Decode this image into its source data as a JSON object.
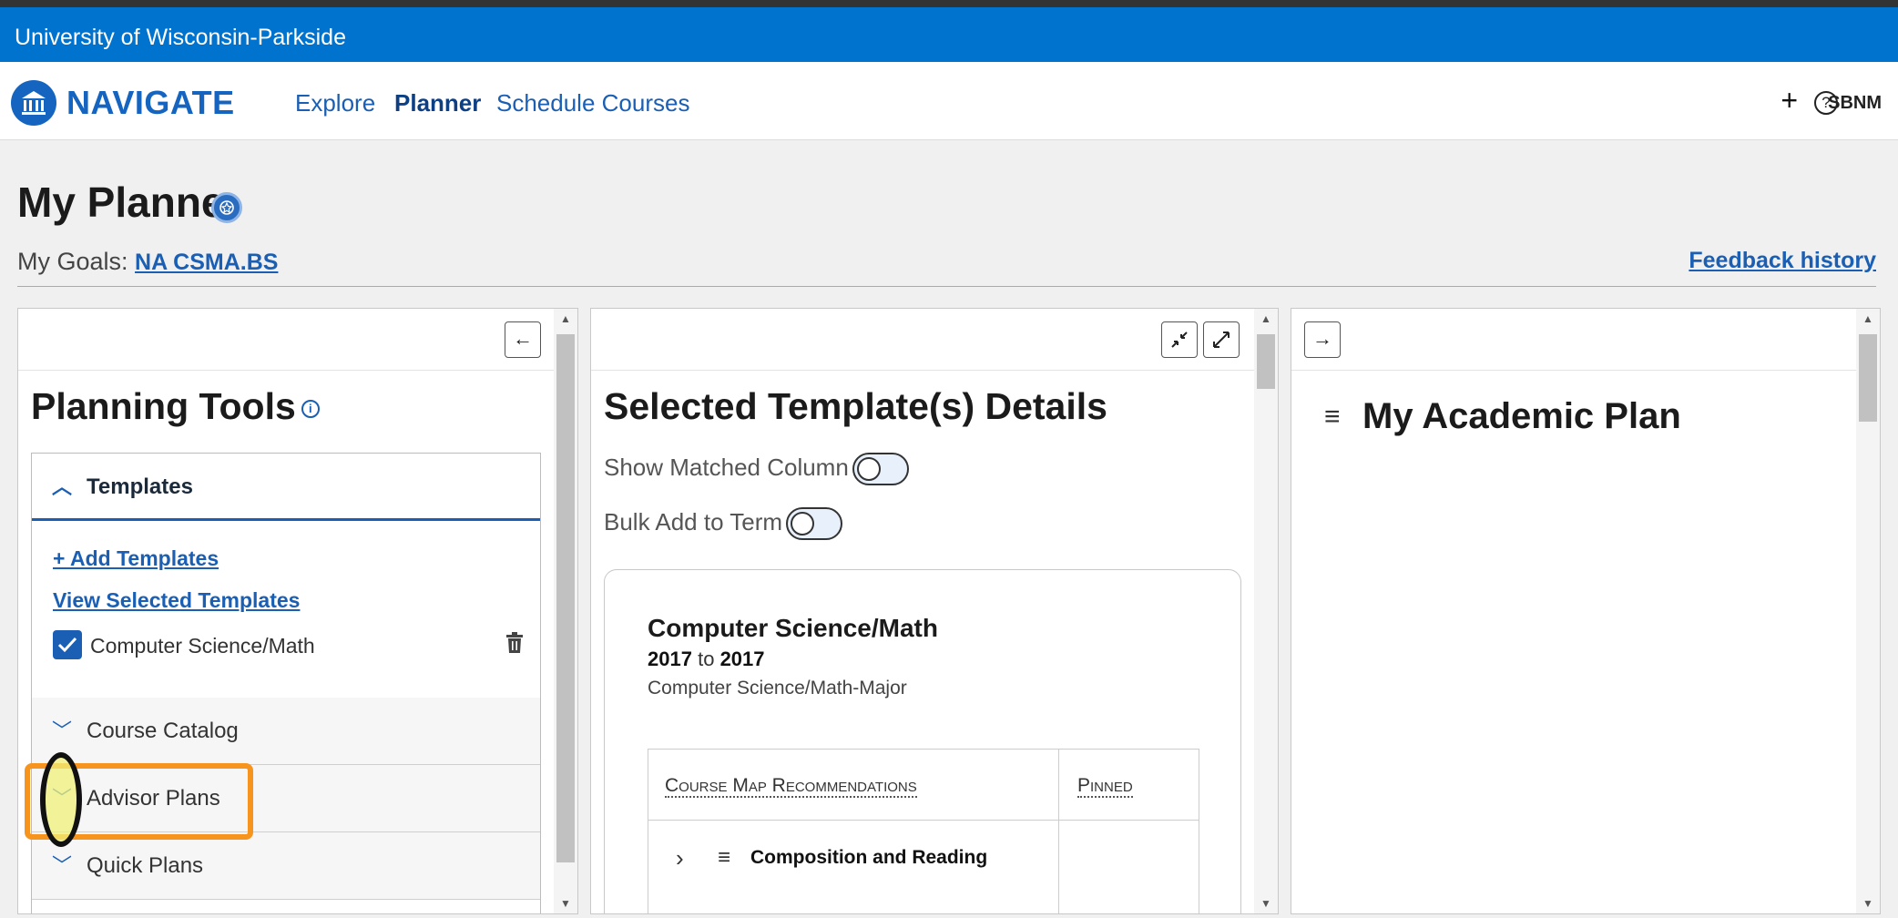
{
  "university": "University of Wisconsin-Parkside",
  "nav": {
    "logo_text": "NAVIGATE",
    "links": [
      "Explore",
      "Planner",
      "Schedule Courses"
    ],
    "active_link": "Planner",
    "plus": "+",
    "help": "?",
    "user": "SBNM"
  },
  "page": {
    "title": "My Planne",
    "goals_label": "My Goals: ",
    "goals_link": "NA CSMA.BS",
    "feedback": "Feedback history"
  },
  "planning_tools": {
    "collapse_btn": "←",
    "title": "Planning Tools",
    "info": "i",
    "templates": {
      "label": "Templates",
      "add_link": "+ Add Templates",
      "view_link": "View Selected Templates",
      "selected": "Computer Science/Math"
    },
    "sections": [
      "Course Catalog",
      "Advisor Plans",
      "Quick Plans"
    ]
  },
  "template_details": {
    "title": "Selected Template(s) Details",
    "toggle_matched": "Show Matched Column",
    "toggle_bulk": "Bulk Add to Term",
    "card": {
      "title": "Computer Science/Math",
      "year_from": "2017",
      "year_to_word": "to",
      "year_to": "2017",
      "subtitle": "Computer Science/Math-Major",
      "col_recommendations": "Course Map Recommendations",
      "col_pinned": "Pinned",
      "row": "Composition and Reading"
    }
  },
  "academic_plan": {
    "expand_btn": "→",
    "title": "My Academic Plan"
  },
  "colors": {
    "brand_blue": "#0073cf",
    "link_blue": "#1a5fb4",
    "highlight_orange": "#f7941d"
  }
}
